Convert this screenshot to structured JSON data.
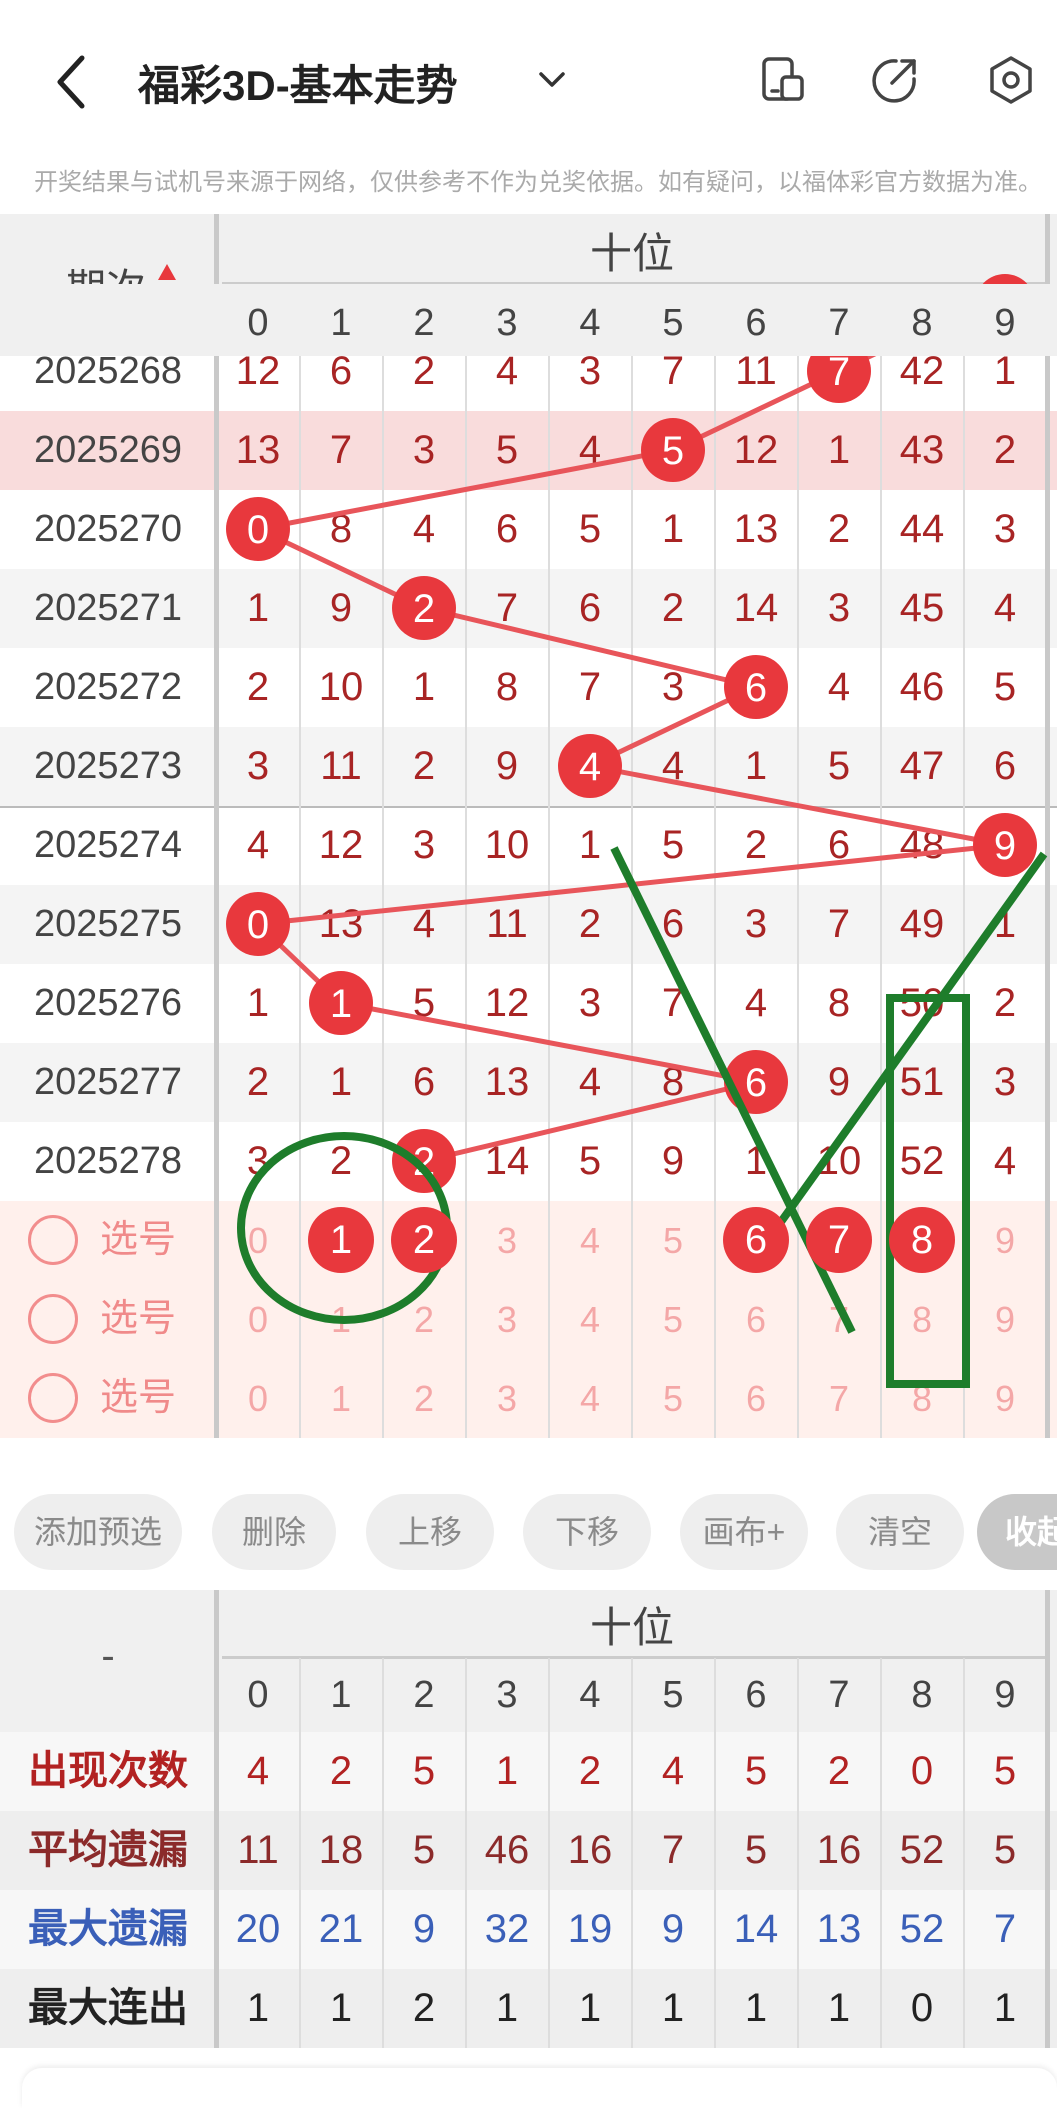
{
  "header": {
    "title": "福彩3D-基本走势",
    "notice": "开奖结果与试机号来源于网络，仅供参考不作为兑奖依据。如有疑问，以福体彩官方数据为准。"
  },
  "table": {
    "position_label": "十位",
    "period_label": "期次",
    "digits": [
      "0",
      "1",
      "2",
      "3",
      "4",
      "5",
      "6",
      "7",
      "8",
      "9"
    ],
    "rows": [
      {
        "period": "2025268",
        "cells": [
          "12",
          "6",
          "2",
          "4",
          "3",
          "7",
          "11",
          "7",
          "42",
          "1"
        ],
        "hit": 7,
        "highlight": false
      },
      {
        "period": "2025269",
        "cells": [
          "13",
          "7",
          "3",
          "5",
          "4",
          "5",
          "12",
          "1",
          "43",
          "2"
        ],
        "hit": 5,
        "highlight": true
      },
      {
        "period": "2025270",
        "cells": [
          "0",
          "8",
          "4",
          "6",
          "5",
          "1",
          "13",
          "2",
          "44",
          "3"
        ],
        "hit": 0,
        "highlight": false
      },
      {
        "period": "2025271",
        "cells": [
          "1",
          "9",
          "2",
          "7",
          "6",
          "2",
          "14",
          "3",
          "45",
          "4"
        ],
        "hit": 2,
        "highlight": false
      },
      {
        "period": "2025272",
        "cells": [
          "2",
          "10",
          "1",
          "8",
          "7",
          "3",
          "6",
          "4",
          "46",
          "5"
        ],
        "hit": 6,
        "highlight": false
      },
      {
        "period": "2025273",
        "cells": [
          "3",
          "11",
          "2",
          "9",
          "4",
          "4",
          "1",
          "5",
          "47",
          "6"
        ],
        "hit": 4,
        "highlight": false
      },
      {
        "period": "2025274",
        "cells": [
          "4",
          "12",
          "3",
          "10",
          "1",
          "5",
          "2",
          "6",
          "48",
          "9"
        ],
        "hit": 9,
        "highlight": false
      },
      {
        "period": "2025275",
        "cells": [
          "0",
          "13",
          "4",
          "11",
          "2",
          "6",
          "3",
          "7",
          "49",
          "1"
        ],
        "hit": 0,
        "highlight": false
      },
      {
        "period": "2025276",
        "cells": [
          "1",
          "1",
          "5",
          "12",
          "3",
          "7",
          "4",
          "8",
          "50",
          "2"
        ],
        "hit": 1,
        "highlight": false
      },
      {
        "period": "2025277",
        "cells": [
          "2",
          "1",
          "6",
          "13",
          "4",
          "8",
          "6",
          "9",
          "51",
          "3"
        ],
        "hit": 6,
        "highlight": false
      },
      {
        "period": "2025278",
        "cells": [
          "3",
          "2",
          "2",
          "14",
          "5",
          "9",
          "1",
          "10",
          "52",
          "4"
        ],
        "hit": 2,
        "highlight": false
      }
    ],
    "pick_label": "选号",
    "pick_rows": [
      {
        "selected": [
          1,
          2,
          6,
          7,
          8
        ]
      },
      {
        "selected": []
      },
      {
        "selected": []
      }
    ]
  },
  "toolbar": {
    "add": "添加预选",
    "delete": "删除",
    "up": "上移",
    "down": "下移",
    "canvas": "画布+",
    "clear": "清空",
    "collapse": "收起"
  },
  "stats": {
    "dash": "-",
    "position_label": "十位",
    "rows": [
      {
        "label": "出现次数",
        "values": [
          "4",
          "2",
          "5",
          "1",
          "2",
          "4",
          "5",
          "2",
          "0",
          "5"
        ],
        "color": "#b22222"
      },
      {
        "label": "平均遗漏",
        "values": [
          "11",
          "18",
          "5",
          "46",
          "16",
          "7",
          "5",
          "16",
          "52",
          "5"
        ],
        "color": "#8b2a2a"
      },
      {
        "label": "最大遗漏",
        "values": [
          "20",
          "21",
          "9",
          "32",
          "19",
          "9",
          "14",
          "13",
          "52",
          "7"
        ],
        "color": "#3a5fb8"
      },
      {
        "label": "最大连出",
        "values": [
          "1",
          "1",
          "2",
          "1",
          "1",
          "1",
          "1",
          "1",
          "0",
          "1"
        ],
        "color": "#222222"
      }
    ]
  },
  "colors": {
    "accent": "#e8383d",
    "annotation": "#1e7d2b",
    "highlight_row": "#f9dcdc",
    "pick_bg": "#fff0ec"
  }
}
